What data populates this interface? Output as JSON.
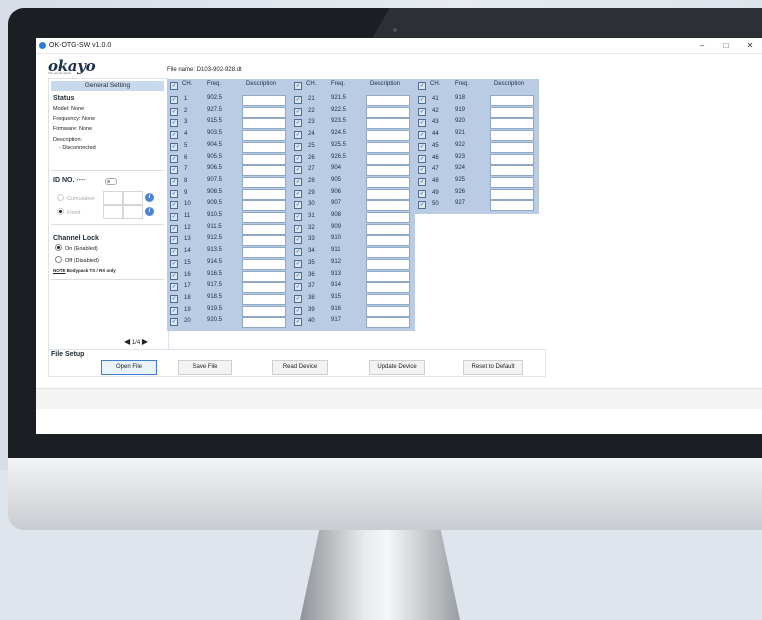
{
  "window": {
    "title": "OK-OTG-SW v1.0.0",
    "controls": [
      "–",
      "□",
      "✕"
    ]
  },
  "logo": {
    "text": "okayo",
    "tagline": "The sound option"
  },
  "file": {
    "label": "File name:",
    "name": "D103-902-928.dt"
  },
  "sidebar": {
    "tab_label": "General Setting",
    "status_heading": "Status",
    "model_label": "Model:",
    "model_value": "None",
    "frequency_label": "Frequency:",
    "frequency_value": "None",
    "firmware_label": "Firmware:",
    "firmware_value": "None",
    "description_label": "Description:",
    "description_value": "- Disconnected",
    "id_heading": "ID NO.",
    "id_value": "----",
    "cumulative_label": "Cumulative",
    "fixed_label": "Fixed",
    "info_icon": "i",
    "channel_lock_heading": "Channel Lock",
    "lock_on_label": "On (Enabled)",
    "lock_off_label": "Off (Disabled)",
    "note_label": "NOTE",
    "note_text": "Bodypack TX / RX only",
    "pager_prev": "◀",
    "pager_text": "1/4",
    "pager_next": "▶"
  },
  "file_setup": {
    "heading": "File Setup",
    "open_label": "Open File",
    "save_label": "Save File",
    "read_label": "Read Device",
    "update_label": "Update Device",
    "reset_label": "Reset to Default"
  },
  "table": {
    "headers": {
      "ch": "CH.",
      "freq": "Freq.",
      "description": "Description"
    },
    "check_glyph": "✓",
    "columns": [
      {
        "channels": [
          {
            "ch": "1",
            "freq": "902.5"
          },
          {
            "ch": "2",
            "freq": "927.5"
          },
          {
            "ch": "3",
            "freq": "915.5"
          },
          {
            "ch": "4",
            "freq": "903.5"
          },
          {
            "ch": "5",
            "freq": "904.5"
          },
          {
            "ch": "6",
            "freq": "905.5"
          },
          {
            "ch": "7",
            "freq": "906.5"
          },
          {
            "ch": "8",
            "freq": "907.5"
          },
          {
            "ch": "9",
            "freq": "908.5"
          },
          {
            "ch": "10",
            "freq": "909.5"
          },
          {
            "ch": "11",
            "freq": "910.5"
          },
          {
            "ch": "12",
            "freq": "911.5"
          },
          {
            "ch": "13",
            "freq": "912.5"
          },
          {
            "ch": "14",
            "freq": "913.5"
          },
          {
            "ch": "15",
            "freq": "914.5"
          },
          {
            "ch": "16",
            "freq": "916.5"
          },
          {
            "ch": "17",
            "freq": "917.5"
          },
          {
            "ch": "18",
            "freq": "918.5"
          },
          {
            "ch": "19",
            "freq": "919.5"
          },
          {
            "ch": "20",
            "freq": "920.5"
          }
        ]
      },
      {
        "channels": [
          {
            "ch": "21",
            "freq": "921.5"
          },
          {
            "ch": "22",
            "freq": "922.5"
          },
          {
            "ch": "23",
            "freq": "923.5"
          },
          {
            "ch": "24",
            "freq": "924.5"
          },
          {
            "ch": "25",
            "freq": "925.5"
          },
          {
            "ch": "26",
            "freq": "926.5"
          },
          {
            "ch": "27",
            "freq": "904"
          },
          {
            "ch": "28",
            "freq": "905"
          },
          {
            "ch": "29",
            "freq": "906"
          },
          {
            "ch": "30",
            "freq": "907"
          },
          {
            "ch": "31",
            "freq": "908"
          },
          {
            "ch": "32",
            "freq": "909"
          },
          {
            "ch": "33",
            "freq": "910"
          },
          {
            "ch": "34",
            "freq": "911"
          },
          {
            "ch": "35",
            "freq": "912"
          },
          {
            "ch": "36",
            "freq": "913"
          },
          {
            "ch": "37",
            "freq": "914"
          },
          {
            "ch": "38",
            "freq": "915"
          },
          {
            "ch": "39",
            "freq": "916"
          },
          {
            "ch": "40",
            "freq": "917"
          }
        ]
      },
      {
        "channels": [
          {
            "ch": "41",
            "freq": "918"
          },
          {
            "ch": "42",
            "freq": "919"
          },
          {
            "ch": "43",
            "freq": "920"
          },
          {
            "ch": "44",
            "freq": "921"
          },
          {
            "ch": "45",
            "freq": "922"
          },
          {
            "ch": "46",
            "freq": "923"
          },
          {
            "ch": "47",
            "freq": "924"
          },
          {
            "ch": "48",
            "freq": "925"
          },
          {
            "ch": "49",
            "freq": "926"
          },
          {
            "ch": "50",
            "freq": "927"
          }
        ]
      }
    ]
  },
  "colors": {
    "accent": "#2a7fd4",
    "table_bg": "#b9cce3",
    "tab_bg": "#c8d9ec"
  }
}
